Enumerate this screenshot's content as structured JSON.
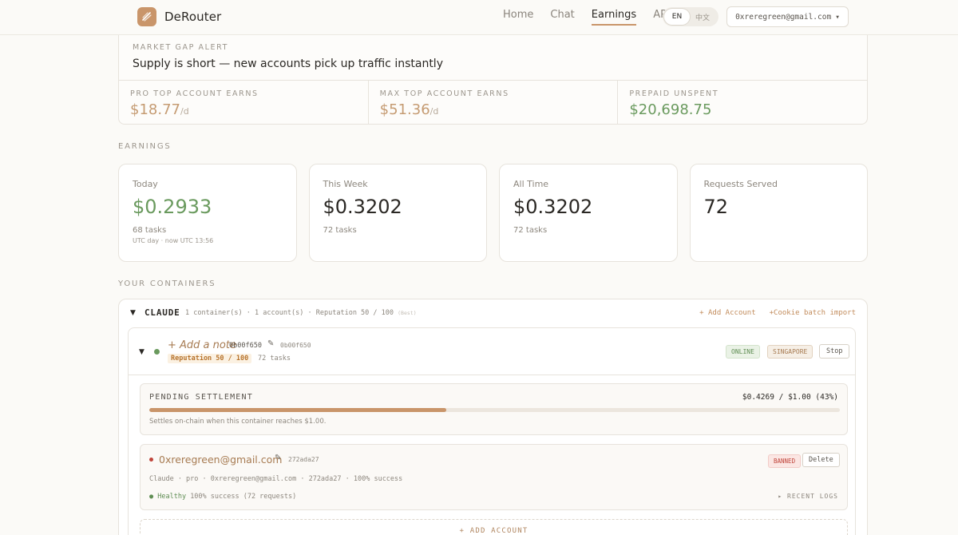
{
  "app": {
    "name": "DeRouter"
  },
  "nav": {
    "items": [
      "Home",
      "Chat",
      "Earnings",
      "API"
    ],
    "active": "Earnings"
  },
  "lang": {
    "en": "EN",
    "zh": "中文",
    "selected": "EN"
  },
  "account_menu": {
    "email": "0xreregreen@gmail.com",
    "caret": "▾"
  },
  "alert": {
    "kicker": "MARKET GAP ALERT",
    "message": "Supply is short — new accounts pick up traffic instantly",
    "stats": [
      {
        "label": "PRO TOP ACCOUNT EARNS",
        "value": "$18.77",
        "unit": "/d"
      },
      {
        "label": "MAX TOP ACCOUNT EARNS",
        "value": "$51.36",
        "unit": "/d"
      },
      {
        "label": "PREPAID UNSPENT",
        "value": "$20,698.75",
        "unit": ""
      }
    ]
  },
  "earnings": {
    "section_label": "EARNINGS",
    "cards": [
      {
        "label": "Today",
        "value": "$0.2933",
        "sub": "68 tasks",
        "tiny": "UTC day · now UTC 13:56"
      },
      {
        "label": "This Week",
        "value": "$0.3202",
        "sub": "72 tasks",
        "tiny": ""
      },
      {
        "label": "All Time",
        "value": "$0.3202",
        "sub": "72 tasks",
        "tiny": ""
      },
      {
        "label": "Requests Served",
        "value": "72",
        "sub": "",
        "tiny": ""
      }
    ]
  },
  "containers": {
    "section_label": "YOUR CONTAINERS",
    "group": {
      "caret": "▼",
      "title": "CLAUDE",
      "meta": "1 container(s) · 1 account(s) · Reputation 50 / 100",
      "meta_dim": "(Best)",
      "add_account": "+ Add Account",
      "cookie_import": "+Cookie batch import"
    },
    "container": {
      "caret": "▼",
      "note": "+ Add a note",
      "id": "0b00f650",
      "edit_icon": "✎",
      "id_secondary": "0b00f650",
      "reputation": "Reputation 50 / 100",
      "tasks": "72 tasks",
      "status": "ONLINE",
      "region": "SINGAPORE",
      "stop": "Stop"
    },
    "pending": {
      "title": "PENDING SETTLEMENT",
      "amount": "$0.4269 / $1.00 (43%)",
      "progress": 0.43,
      "note": "Settles on-chain when this container reaches $1.00."
    },
    "account": {
      "email": "0xreregreen@gmail.com",
      "edit_icon": "✎",
      "id": "272ada27",
      "status": "BANNED",
      "delete": "Delete",
      "meta": "Claude · pro · 0xreregreen@gmail.com · 272ada27 · 100% success",
      "health_label": "● Healthy",
      "health_detail": "100% success (72 requests)",
      "logs": "▸ RECENT LOGS"
    },
    "add_account_footer": "+ ADD ACCOUNT"
  },
  "colors": {
    "accent": "#c9956a",
    "green": "#6a9a5e",
    "red": "#c0443a"
  }
}
